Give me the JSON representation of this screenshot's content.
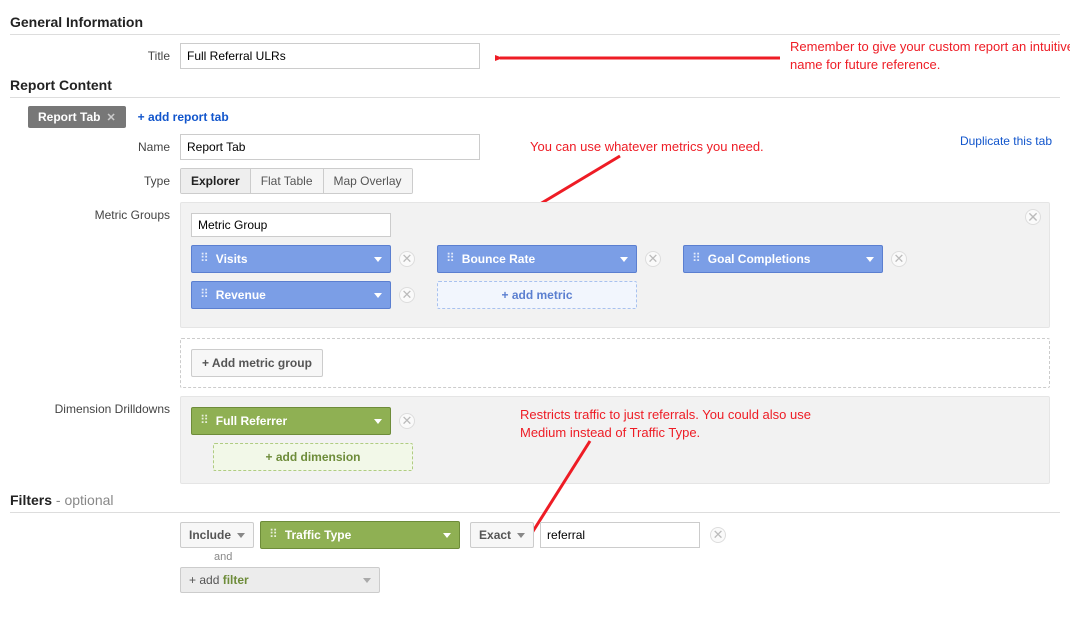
{
  "sections": {
    "general_info": "General Information",
    "report_content": "Report Content",
    "filters": "Filters",
    "filters_suffix": " - optional"
  },
  "labels": {
    "title": "Title",
    "name": "Name",
    "type": "Type",
    "metric_groups": "Metric Groups",
    "dim_drill": "Dimension Drilldowns"
  },
  "title_value": "Full Referral ULRs",
  "tab": {
    "label": "Report Tab",
    "add_tab": "+ add report tab",
    "duplicate": "Duplicate this tab"
  },
  "name_value": "Report Tab",
  "types": {
    "explorer": "Explorer",
    "flat": "Flat Table",
    "map": "Map Overlay"
  },
  "metric_group_name": "Metric Group",
  "metrics": {
    "m0": "Visits",
    "m1": "Bounce Rate",
    "m2": "Goal Completions",
    "m3": "Revenue",
    "add": "+ add metric"
  },
  "add_metric_group": "+ Add metric group",
  "dimension": {
    "d0": "Full Referrer",
    "add": "+ add dimension"
  },
  "filter": {
    "include": "Include",
    "dim": "Traffic Type",
    "match": "Exact",
    "value": "referral",
    "and": "and",
    "add_prefix": "+ add ",
    "add_word": "filter"
  },
  "annotations": {
    "a1": "Remember to give your custom report an intuitive name for future reference.",
    "a2": "You can use whatever metrics you need.",
    "a3": "Restricts traffic to just referrals. You could also use Medium instead of Traffic Type."
  }
}
